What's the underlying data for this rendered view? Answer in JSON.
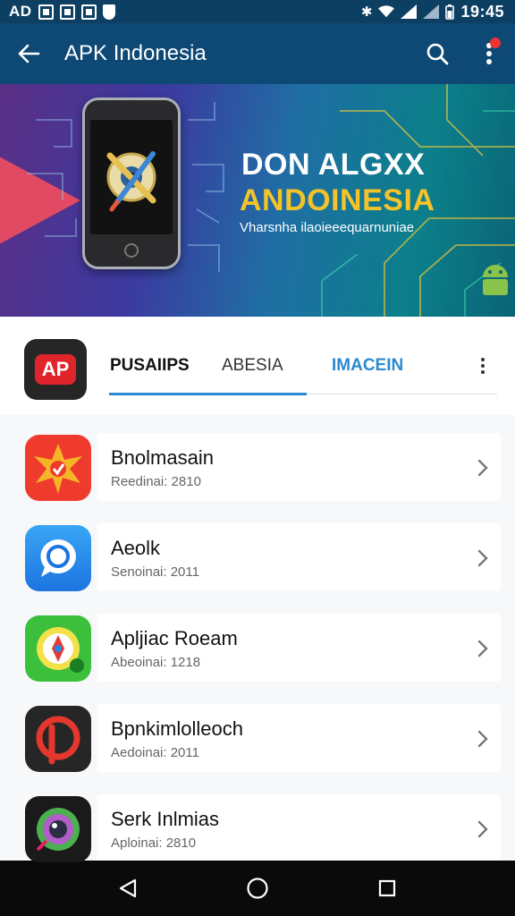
{
  "status_bar": {
    "left_text": "AD",
    "time": "19:45",
    "icons": [
      "photo-icon",
      "app-icon",
      "image-icon",
      "shield-icon",
      "bluetooth-icon",
      "wifi-icon",
      "signal-icon",
      "battery-icon"
    ]
  },
  "app_bar": {
    "title": "APK Indonesia",
    "icons": [
      "back-arrow-icon",
      "search-icon",
      "more-vert-icon"
    ]
  },
  "banner": {
    "headline_1": "DON ALGXX",
    "headline_2": "ANDOINESIA",
    "subtitle": "Vharsnha ilaoieeequarnuniae"
  },
  "tabs": {
    "logo_text": "AP",
    "items": [
      {
        "label": "PUSAIIPS"
      },
      {
        "label": "ABESIA"
      },
      {
        "label": "IMACEIN"
      }
    ],
    "active_index": 0
  },
  "apps": [
    {
      "name": "Bnolmasain",
      "meta": "Reedinai: 2810",
      "icon": "star-burst-icon"
    },
    {
      "name": "Aeolk",
      "meta": "Senoinai: 2011",
      "icon": "chat-bubble-icon"
    },
    {
      "name": "Apljiac Roeam",
      "meta": "Abeoinai: 1218",
      "icon": "compass-pin-icon"
    },
    {
      "name": "Bpnkimlolleoch",
      "meta": "Aedoinai: 2011",
      "icon": "p-logo-icon"
    },
    {
      "name": "Serk Inlmias",
      "meta": "Aploinai: 2810",
      "icon": "camera-eye-icon"
    }
  ],
  "colors": {
    "app_bar": "#0e4874",
    "status_bar": "#0d3f63",
    "accent": "#2b8ad0",
    "banner_highlight": "#f4c22a"
  },
  "nav_bar": {
    "icons": [
      "back-triangle-icon",
      "home-circle-icon",
      "recents-square-icon"
    ]
  }
}
